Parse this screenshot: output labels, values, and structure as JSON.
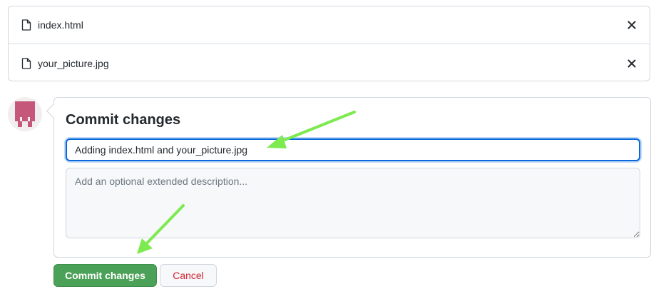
{
  "files": [
    {
      "name": "index.html",
      "icon": "file-icon",
      "remove_icon": "close-icon"
    },
    {
      "name": "your_picture.jpg",
      "icon": "file-icon",
      "remove_icon": "close-icon"
    }
  ],
  "avatar": {
    "icon": "identicon-avatar",
    "color": "#c5577a"
  },
  "commit": {
    "title": "Commit changes",
    "summary_value": "Adding index.html and your_picture.jpg",
    "description_placeholder": "Add an optional extended description..."
  },
  "buttons": {
    "commit_label": "Commit changes",
    "cancel_label": "Cancel"
  },
  "annotations": {
    "arrow_color": "#7dea4f",
    "arrow_icon": "arrow-annotation"
  },
  "colors": {
    "accent": "#0969da",
    "commit_button": "#4ca158",
    "cancel_text": "#cf222e",
    "border": "#d0d7de"
  }
}
